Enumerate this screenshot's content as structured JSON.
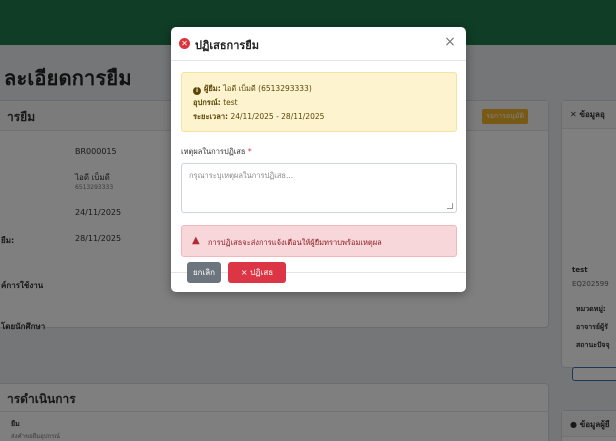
{
  "page": {
    "title": "ละเอียดการยืม"
  },
  "left_card": {
    "title": "ารยืม",
    "badge": "รอการอนุมัติ",
    "rows": [
      {
        "label": "",
        "value": "BR000015"
      },
      {
        "label": "",
        "value": "ไอดี เบ็มดี",
        "sub": "6513293333"
      },
      {
        "label": "",
        "value": "24/11/2025"
      },
      {
        "label": "ยืม:",
        "value": "28/11/2025"
      }
    ],
    "section_a": "ค์การใช้งาน",
    "section_b": "โดยนักศึกษา"
  },
  "steps_card": {
    "title": "ารดำเนินการ",
    "step_label": "ยืม",
    "step_sub": "ส่งคำขอยืมอุปกรณ์"
  },
  "right_card": {
    "title": "ข้อมูลอุ",
    "item_name": "test",
    "item_code": "EQ202599",
    "field_1": "หมวดหมู่:",
    "field_2": "อาจารย์ผู้รั",
    "field_3": "สถานะปัจจุ"
  },
  "right_card2": {
    "title": "ข้อมูลผู้ยื"
  },
  "modal": {
    "title": "ปฏิเสธการยืม",
    "close_glyph": "×",
    "borrower_label": "ผู้ยืม:",
    "borrower_value": "ไอดี เบ็มดี (6513293333)",
    "item_label": "อุปกรณ์:",
    "item_value": "test",
    "period_label": "ระยะเวลา:",
    "period_value": "24/11/2025 - 28/11/2025",
    "reason_label": "เหตุผลในการปฏิเสธ",
    "required_mark": "*",
    "reason_placeholder": "กรุณาระบุเหตุผลในการปฏิเสธ...",
    "warning_text": "การปฏิเสธจะส่งการแจ้งเตือนให้ผู้ยืมทราบพร้อมเหตุผล",
    "cancel_label": "ยกเลิก",
    "reject_label": "× ปฏิเสธ"
  },
  "colors": {
    "topbar": "#1f7a4d",
    "danger": "#dc3545",
    "warning_bg": "#fdf3cf",
    "alert_bg": "#f8d7da",
    "secondary": "#6c757d"
  },
  "icons": {
    "modal_header": "x-circle-icon",
    "info": "info-circle-icon",
    "warning": "warning-triangle-icon",
    "close": "close-icon"
  }
}
